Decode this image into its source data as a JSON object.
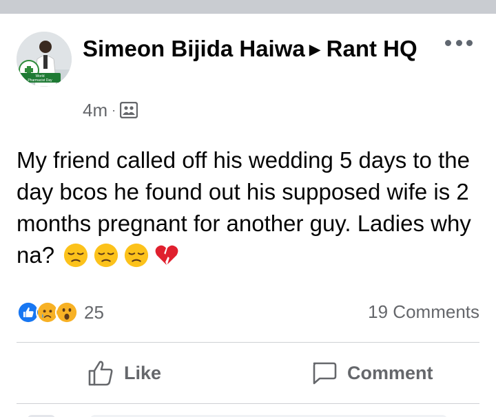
{
  "post": {
    "author": "Simeon Bijida Haiwa",
    "group": "Rant HQ",
    "time": "4m",
    "separator": "·",
    "audience_icon": "group-audience-icon",
    "body": "My friend called off his wedding 5 days to the day bcos he found out his supposed wife is 2 months pregnant for another guy. Ladies why na?",
    "emojis": [
      "pensive-face",
      "pensive-face",
      "pensive-face",
      "broken-heart"
    ],
    "avatar_badge_text": "World Pharmacist Day",
    "more_icon": "more-options-icon"
  },
  "reactions": {
    "icons": [
      "like-reaction",
      "sad-reaction",
      "wow-reaction"
    ],
    "count": "25"
  },
  "comments": {
    "label": "19 Comments"
  },
  "actions": {
    "like_label": "Like",
    "comment_label": "Comment"
  },
  "colors": {
    "primary_text": "#050505",
    "secondary_text": "#65676b",
    "like_blue": "#1877f2",
    "divider": "#ced0d4"
  }
}
